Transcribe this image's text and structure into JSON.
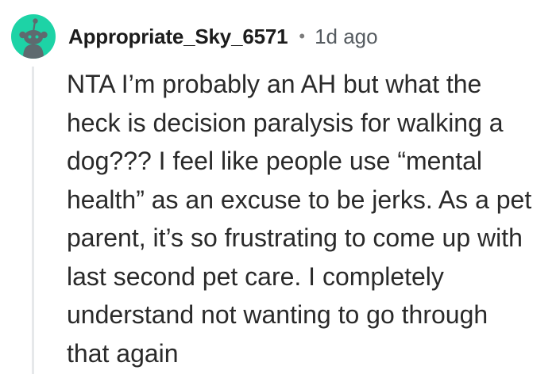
{
  "comment": {
    "author": "Appropriate_Sky_6571",
    "separator": "•",
    "age": "1d ago",
    "avatar_icon": "reddit-snoo-avatar-icon",
    "avatar_color": "#1dd3a6",
    "body_lines": [
      "NTA I’m probably an AH but what the",
      "heck is decision paralysis for walking a",
      "dog??? I feel like people use “mental",
      "health” as an excuse to be jerks. As a pet",
      "parent, it’s so frustrating to come up with",
      "last second pet care. I completely",
      "understand not wanting to go through",
      "that again"
    ]
  }
}
